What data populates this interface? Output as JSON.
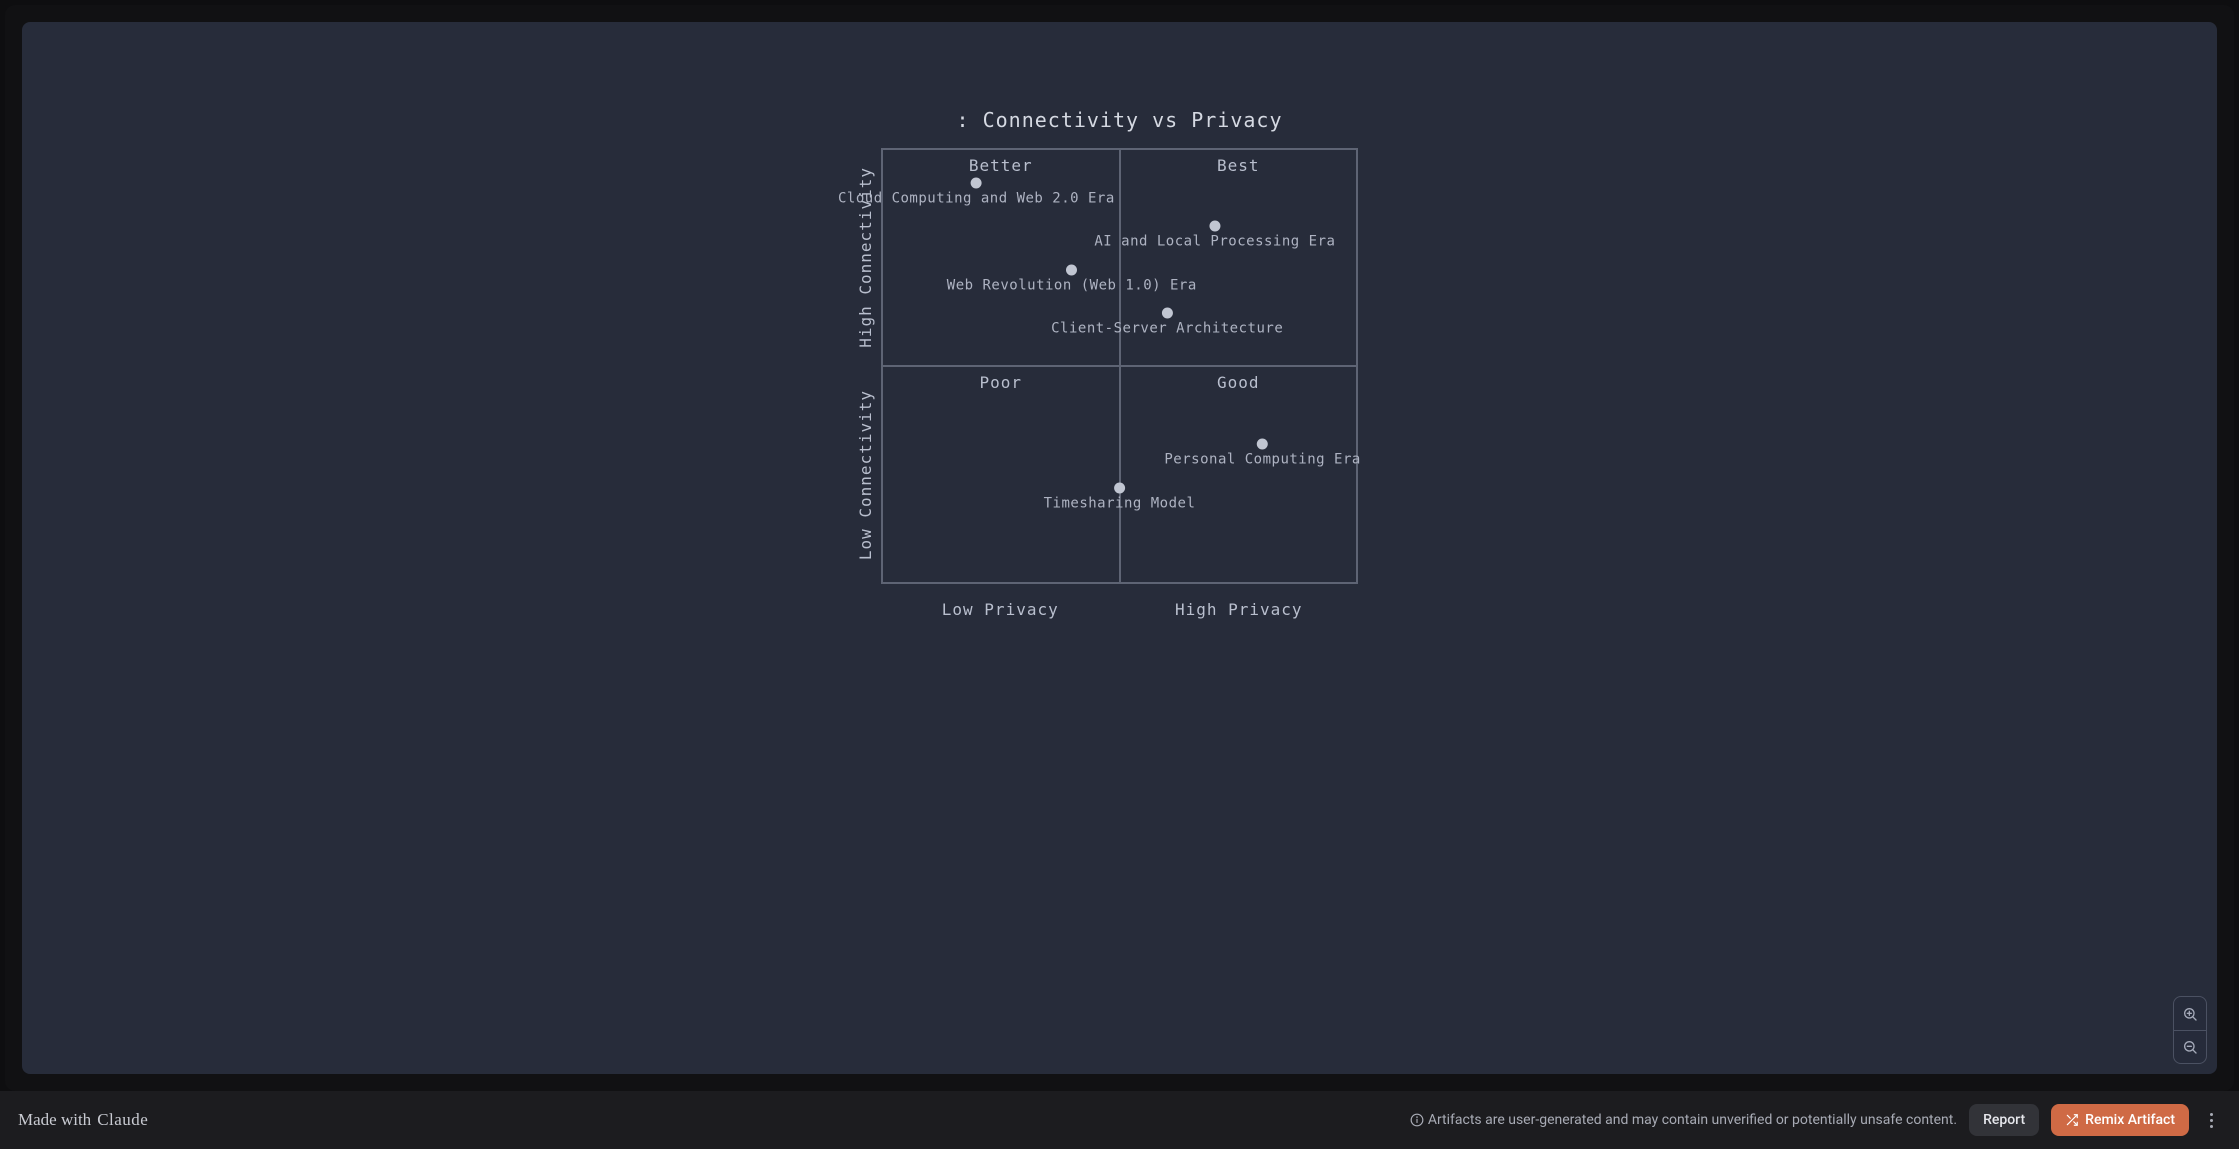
{
  "chart_data": {
    "type": "scatter",
    "title": ": Connectivity vs Privacy",
    "xlabel_low": "Low Privacy",
    "xlabel_high": "High Privacy",
    "ylabel_low": "Low Connectivity",
    "ylabel_high": "High Connectivity",
    "xlim": [
      0,
      10
    ],
    "ylim": [
      0,
      10
    ],
    "quadrants": {
      "top_left": "Better",
      "top_right": "Best",
      "bottom_left": "Poor",
      "bottom_right": "Good"
    },
    "series": [
      {
        "name": "Cloud Computing and Web 2.0 Era",
        "x": 2.0,
        "y": 9.0
      },
      {
        "name": "AI and Local Processing Era",
        "x": 7.0,
        "y": 8.0
      },
      {
        "name": "Web Revolution (Web 1.0) Era",
        "x": 4.0,
        "y": 7.0
      },
      {
        "name": "Client-Server Architecture",
        "x": 6.0,
        "y": 6.0
      },
      {
        "name": "Personal Computing Era",
        "x": 8.0,
        "y": 3.0
      },
      {
        "name": "Timesharing Model",
        "x": 5.0,
        "y": 2.0
      }
    ]
  },
  "footer": {
    "made_with_prefix": "Made with",
    "made_with_brand": "Claude",
    "disclaimer": "Artifacts are user-generated and may contain unverified or potentially unsafe content.",
    "report_label": "Report",
    "remix_label": "Remix Artifact"
  }
}
